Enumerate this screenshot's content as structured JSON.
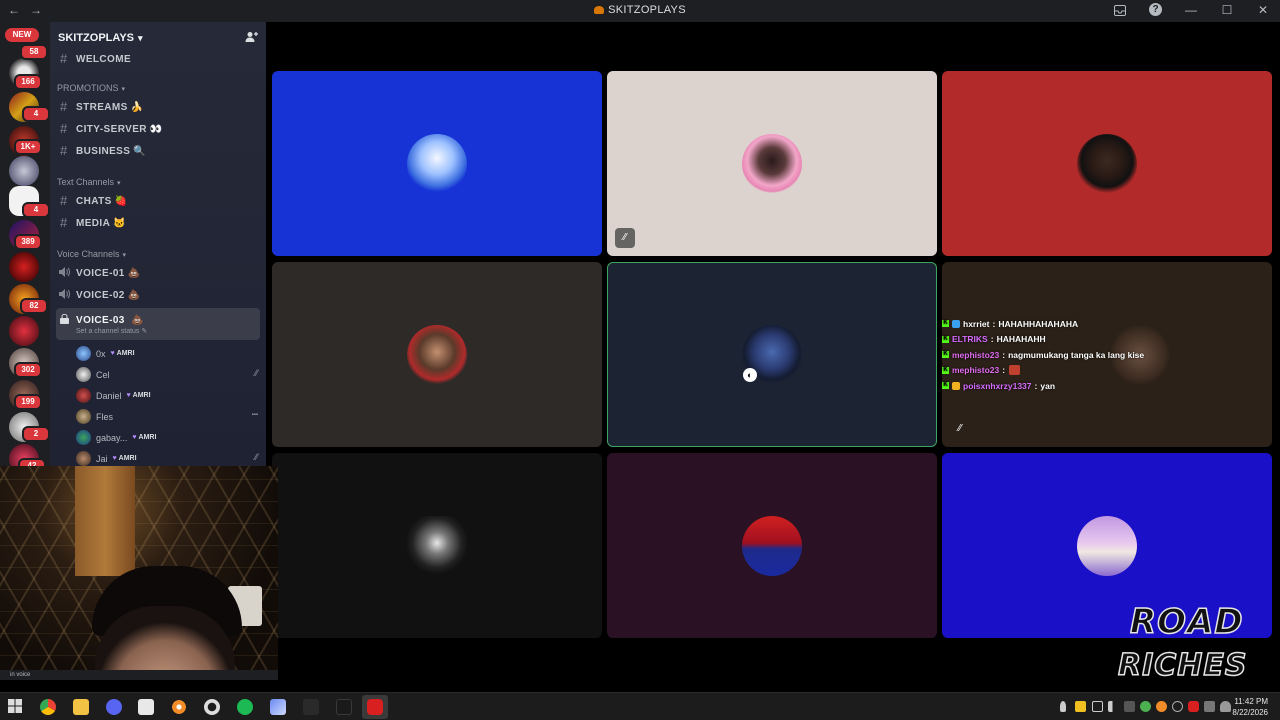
{
  "window": {
    "title": "SKITZOPLAYS",
    "nav_back": "←",
    "nav_forward": "→",
    "minimize": "—",
    "maximize": "☐",
    "close": "✕"
  },
  "rail": {
    "new_label": "NEW",
    "badges": [
      "58",
      "166",
      "4",
      "1K+",
      "4",
      "389",
      "82",
      "302",
      "199",
      "2",
      "42"
    ]
  },
  "sidebar": {
    "server_name": "SKITZOPLAYS",
    "channels_top": [
      {
        "label": "WELCOME",
        "emoji": ""
      }
    ],
    "categories": [
      {
        "label": "PROMOTIONS",
        "channels": [
          {
            "label": "STREAMS",
            "emoji": "🍌"
          },
          {
            "label": "CITY-SERVER",
            "emoji": "👀"
          },
          {
            "label": "BUSINESS",
            "emoji": "🔍"
          }
        ]
      },
      {
        "label": "Text Channels",
        "channels": [
          {
            "label": "CHATS",
            "emoji": "🍓"
          },
          {
            "label": "MEDIA",
            "emoji": "🐱"
          }
        ]
      }
    ],
    "voice_category": "Voice Channels",
    "voice_channels": [
      {
        "label": "VOICE-01",
        "emoji": "💩"
      },
      {
        "label": "VOICE-02",
        "emoji": "💩"
      }
    ],
    "active_voice": {
      "label": "VOICE-03",
      "emoji": "💩",
      "status_placeholder": "Set a channel status"
    },
    "voice_users": [
      {
        "name": "0x",
        "tag": "AMRI",
        "muted": false
      },
      {
        "name": "Cel",
        "tag": "",
        "muted": true
      },
      {
        "name": "Daniel",
        "tag": "AMRI",
        "muted": false
      },
      {
        "name": "Fles",
        "tag": "",
        "muted": false
      },
      {
        "name": "gabay...",
        "tag": "AMRI",
        "muted": false
      },
      {
        "name": "Jai",
        "tag": "AMRI",
        "muted": true
      }
    ]
  },
  "footer": {
    "status_text": "in voice"
  },
  "chat": [
    {
      "user": "hxrriet",
      "user_color": "#ffffff",
      "message": "HAHAHHAHAHAHA"
    },
    {
      "user": "ELTRIKS",
      "user_color": "#d56cff",
      "message": "HAHAHAHH"
    },
    {
      "user": "mephisto23",
      "user_color": "#e06cf0",
      "message": "nagmumukang tanga ka lang kise"
    },
    {
      "user": "mephisto23",
      "user_color": "#e06cf0",
      "message": ""
    },
    {
      "user": "poisxnhxrzy1337",
      "user_color": "#d56cff",
      "message": "yan"
    }
  ],
  "watermark": {
    "line1": "ROAD",
    "line2": "RICHES"
  },
  "clock": {
    "time": "11:42 PM",
    "date": "8/22/2026"
  },
  "colors": {
    "discord_dark": "#1e1f22",
    "sidebar": "#2b2d31",
    "speaking_green": "#3ba55c",
    "badge_red": "#da373c",
    "kick_green": "#53fc18"
  }
}
